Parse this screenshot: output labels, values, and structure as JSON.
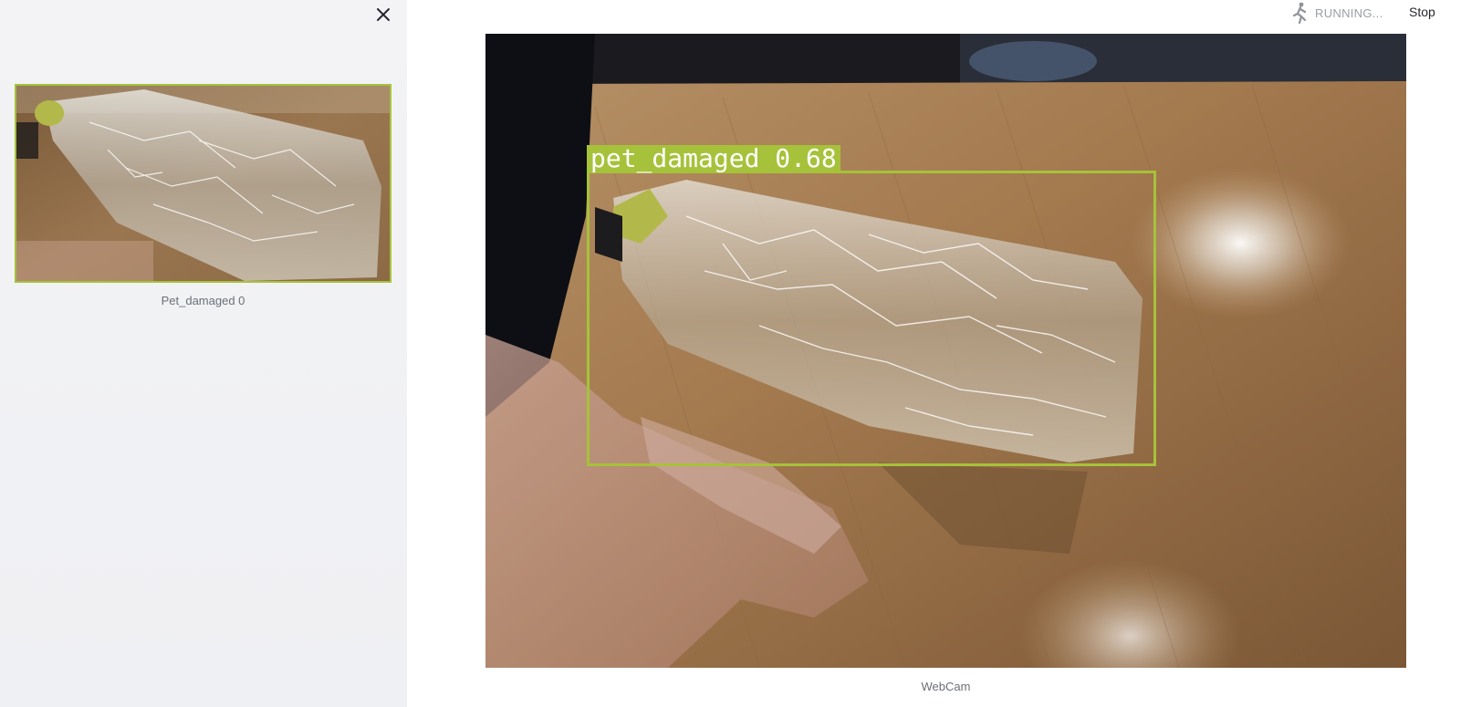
{
  "status": {
    "running_text": "RUNNING...",
    "stop_label": "Stop"
  },
  "sidebar": {
    "close_icon": "close-icon",
    "thumbnail_caption": "Pet_damaged 0"
  },
  "main": {
    "video_caption": "WebCam",
    "detection": {
      "label": "pet_damaged 0.68",
      "class": "pet_damaged",
      "confidence": 0.68
    }
  },
  "colors": {
    "detection_box": "#a6c23a",
    "sidebar_bg": "#f0f1f4",
    "caption_text": "#6b6f76"
  }
}
